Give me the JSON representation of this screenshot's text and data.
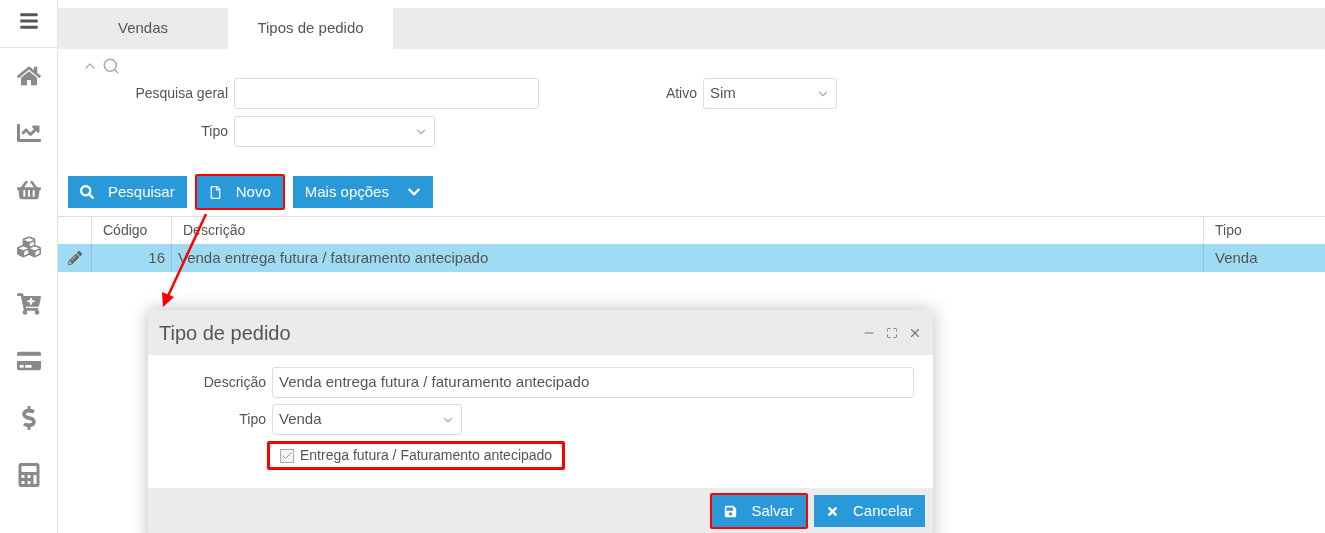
{
  "tabs": [
    {
      "label": "Vendas",
      "selected": false
    },
    {
      "label": "Tipos de pedido",
      "selected": true
    }
  ],
  "filters": {
    "general": {
      "label": "Pesquisa geral"
    },
    "type": {
      "label": "Tipo"
    },
    "active": {
      "label": "Ativo",
      "value": "Sim"
    }
  },
  "buttons": [
    {
      "kind": "search",
      "label": "Pesquisar",
      "highlighted": false
    },
    {
      "kind": "new",
      "label": "Novo",
      "highlighted": true
    },
    {
      "kind": "dropdown",
      "label": "Mais opções",
      "highlighted": false
    }
  ],
  "table": {
    "columns": [
      "Código",
      "Descrição",
      "Tipo"
    ],
    "rows": [
      {
        "selected": true,
        "cells": [
          "16",
          "Venda entrega futura / faturamento antecipado",
          "Venda"
        ]
      }
    ]
  },
  "dialog": {
    "title": "Tipo de pedido",
    "description": {
      "label": "Descrição",
      "value": "Venda entrega futura / faturamento antecipado"
    },
    "type": {
      "label": "Tipo",
      "value": "Venda"
    },
    "checkbox": {
      "label": "Entrega futura / Faturamento antecipado",
      "checked": true,
      "highlighted": true
    },
    "buttons": [
      {
        "kind": "save",
        "label": "Salvar",
        "highlighted": true
      },
      {
        "kind": "cancel",
        "label": "Cancelar",
        "highlighted": false
      }
    ]
  }
}
